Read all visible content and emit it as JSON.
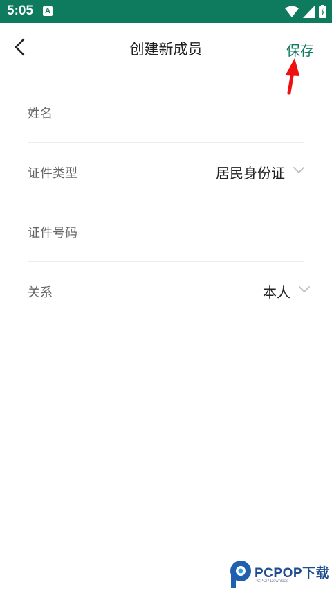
{
  "status_bar": {
    "time": "5:05",
    "notification_letter": "A",
    "icons": [
      "wifi-icon",
      "signal-icon",
      "battery-charging-icon"
    ],
    "background_color": "#0e7a5e"
  },
  "header": {
    "title": "创建新成员",
    "save_label": "保存",
    "accent_color": "#0e7a5e",
    "back_icon": "chevron-left-icon"
  },
  "form": {
    "name_label": "姓名",
    "id_type_label": "证件类型",
    "id_type_value": "居民身份证",
    "id_number_label": "证件号码",
    "relation_label": "关系",
    "relation_value": "本人"
  },
  "watermark": {
    "brand": "PCPOP下载",
    "sub": "PCPOP Download"
  }
}
